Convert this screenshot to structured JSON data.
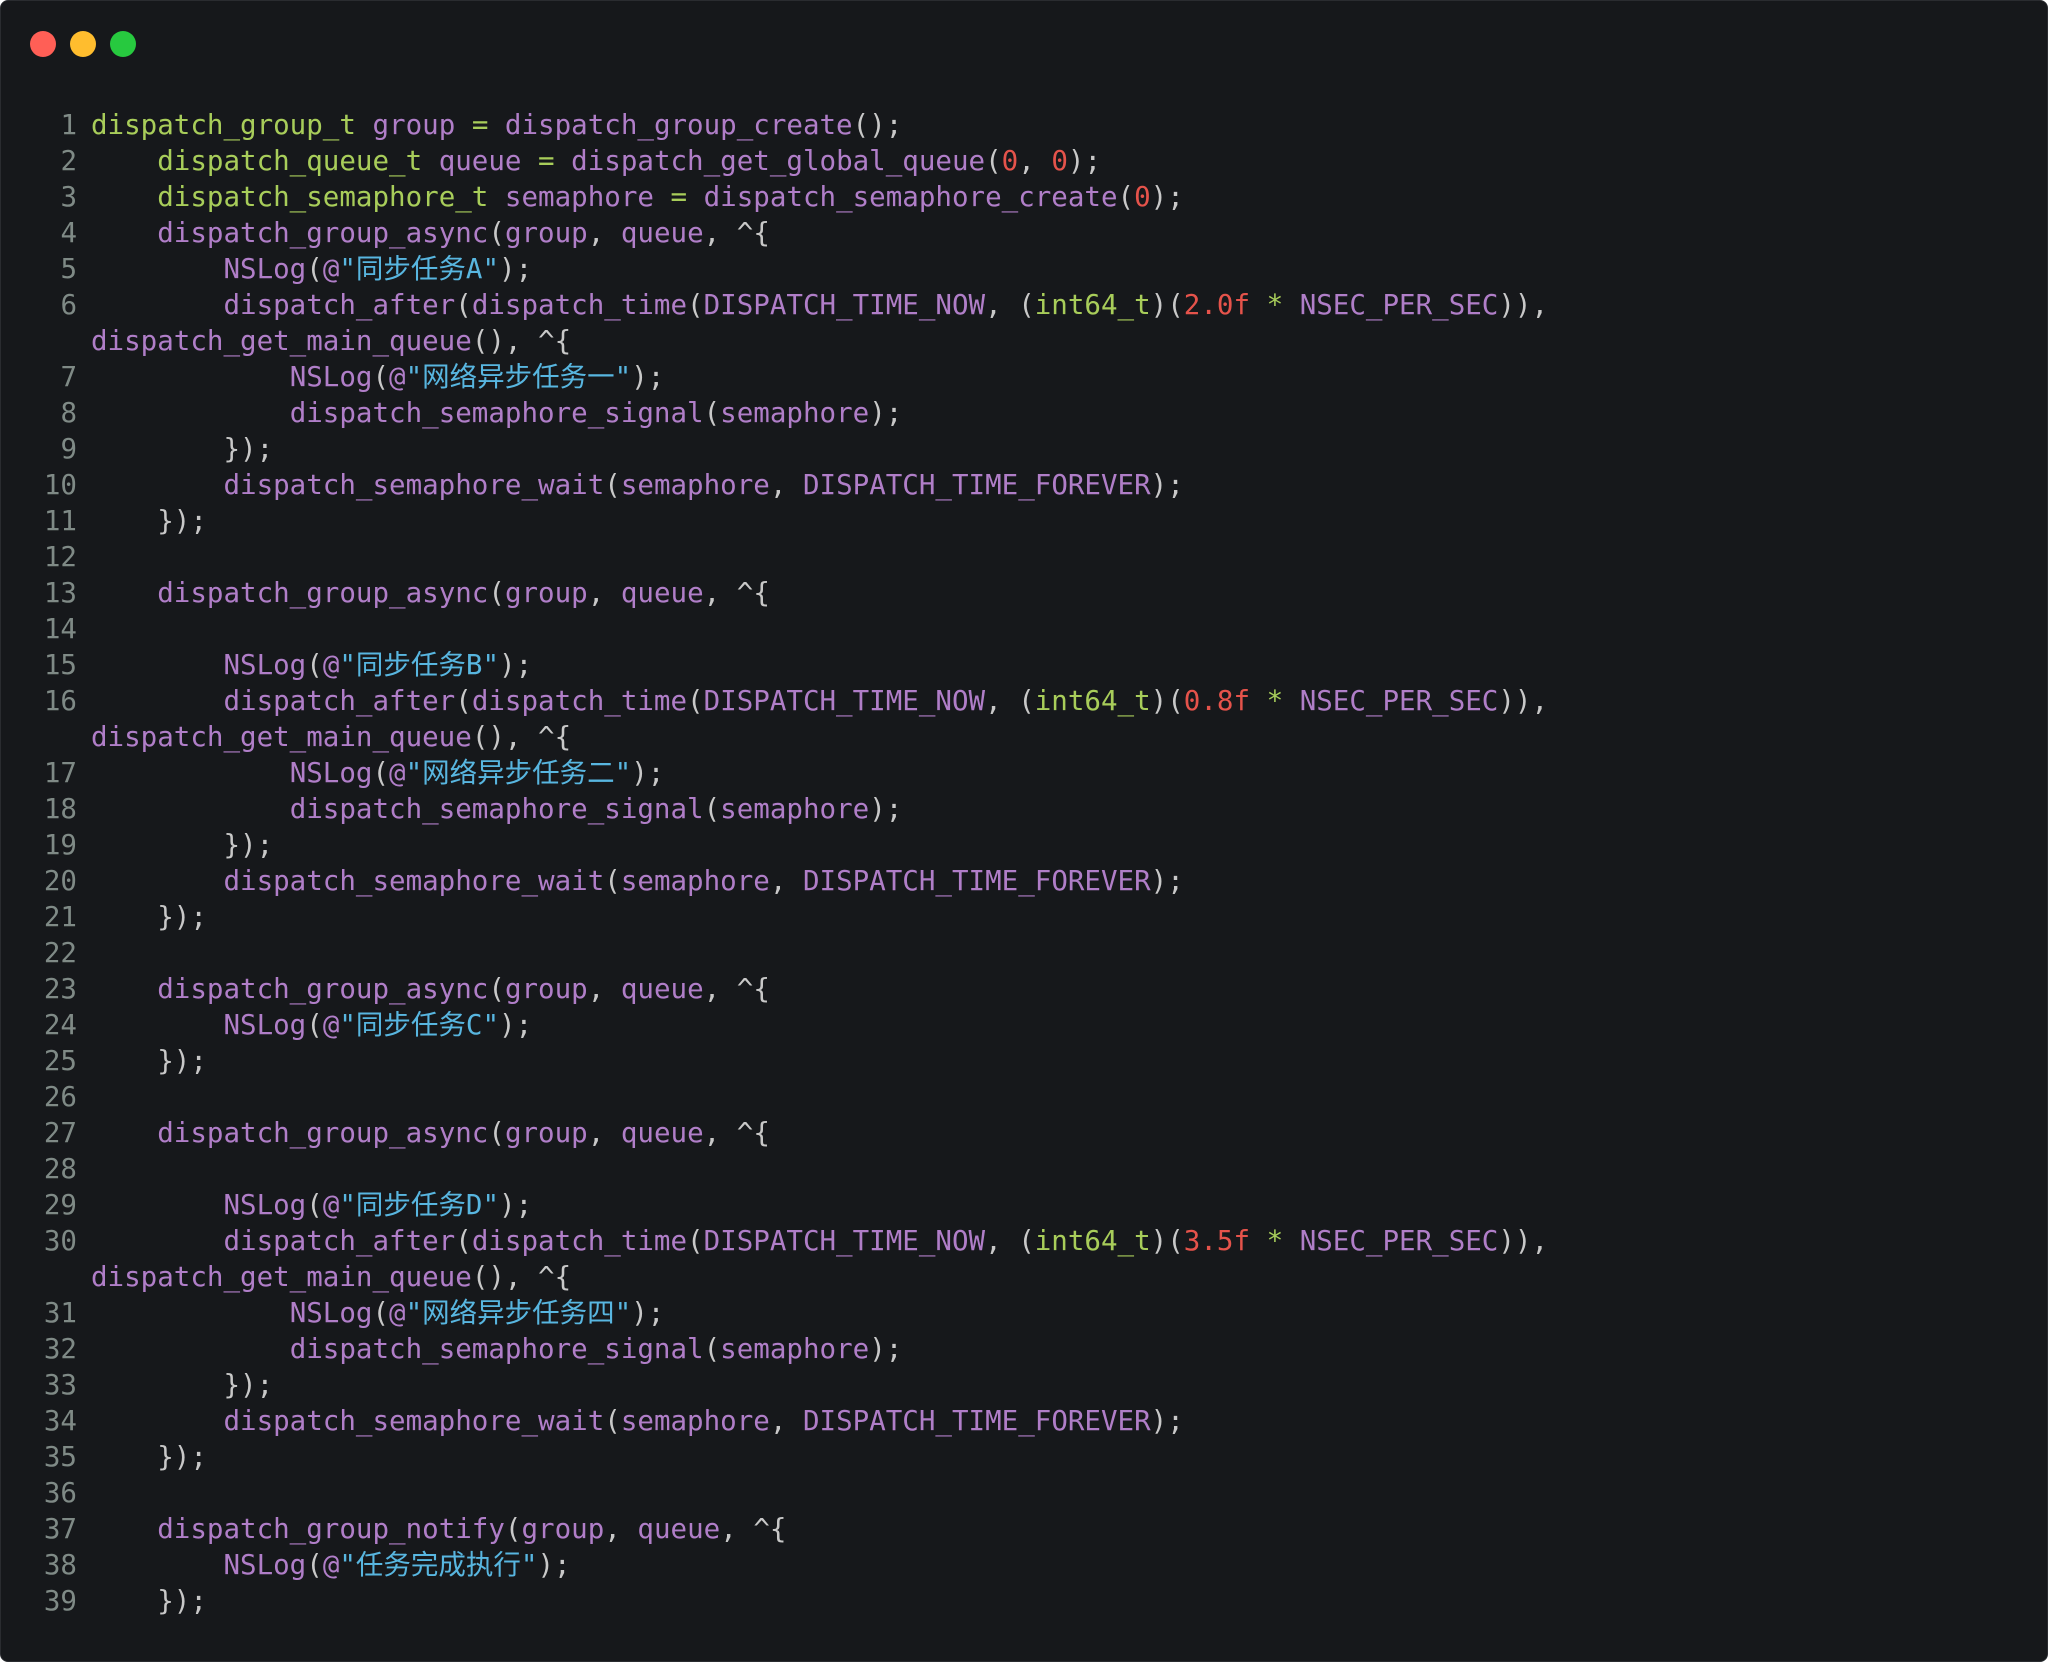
{
  "window": {
    "traffic_lights": [
      {
        "name": "close-button",
        "color": "#ff5f56"
      },
      {
        "name": "minimize-button",
        "color": "#ffbd2e"
      },
      {
        "name": "zoom-button",
        "color": "#27c93f"
      }
    ]
  },
  "colors": {
    "background": "#16181b",
    "line_number": "#7f8a86",
    "default": "#c8c8c8",
    "function": "#b07ec8",
    "type": "#a8cd5a",
    "number": "#e5534b",
    "string": "#58b6e0"
  },
  "code_lines": [
    {
      "num": "1",
      "tokens": [
        [
          "dispatch_group_t",
          "t"
        ],
        [
          " group ",
          "v"
        ],
        [
          "=",
          "t"
        ],
        [
          " dispatch_group_create",
          "f"
        ],
        [
          "();",
          "p"
        ]
      ]
    },
    {
      "num": "2",
      "tokens": [
        [
          "    "
        ],
        [
          "dispatch_queue_t",
          "t"
        ],
        [
          " queue ",
          "f"
        ],
        [
          "=",
          "t"
        ],
        [
          " dispatch_get_global_queue",
          "f"
        ],
        [
          "(",
          "p"
        ],
        [
          "0",
          "n"
        ],
        [
          ", ",
          "p"
        ],
        [
          "0",
          "n"
        ],
        [
          ");",
          "p"
        ]
      ]
    },
    {
      "num": "3",
      "tokens": [
        [
          "    "
        ],
        [
          "dispatch_semaphore_t",
          "t"
        ],
        [
          " semaphore ",
          "f"
        ],
        [
          "=",
          "t"
        ],
        [
          " dispatch_semaphore_create",
          "f"
        ],
        [
          "(",
          "p"
        ],
        [
          "0",
          "n"
        ],
        [
          ");",
          "p"
        ]
      ]
    },
    {
      "num": "4",
      "tokens": [
        [
          "    "
        ],
        [
          "dispatch_group_async",
          "f"
        ],
        [
          "(",
          "p"
        ],
        [
          "group",
          "f"
        ],
        [
          ", ",
          "p"
        ],
        [
          "queue",
          "f"
        ],
        [
          ", ^{",
          "p"
        ]
      ]
    },
    {
      "num": "5",
      "tokens": [
        [
          "        "
        ],
        [
          "NSLog",
          "f"
        ],
        [
          "(",
          "p"
        ],
        [
          "@",
          "f"
        ],
        [
          "\"同步任务A\"",
          "s"
        ],
        [
          ");",
          "p"
        ]
      ]
    },
    {
      "num": "6",
      "tokens": [
        [
          "        "
        ],
        [
          "dispatch_after",
          "f"
        ],
        [
          "(",
          "p"
        ],
        [
          "dispatch_time",
          "f"
        ],
        [
          "(",
          "p"
        ],
        [
          "DISPATCH_TIME_NOW",
          "f"
        ],
        [
          ", (",
          "p"
        ],
        [
          "int64_t",
          "t"
        ],
        [
          ")(",
          "p"
        ],
        [
          "2.0f",
          "n"
        ],
        [
          " * ",
          "t"
        ],
        [
          "NSEC_PER_SEC",
          "f"
        ],
        [
          ")),",
          "p"
        ]
      ]
    },
    {
      "num": "",
      "tokens": [
        [
          "dispatch_get_main_queue",
          "f"
        ],
        [
          "(), ^{",
          "p"
        ]
      ]
    },
    {
      "num": "7",
      "tokens": [
        [
          "            "
        ],
        [
          "NSLog",
          "f"
        ],
        [
          "(",
          "p"
        ],
        [
          "@",
          "f"
        ],
        [
          "\"网络异步任务一\"",
          "s"
        ],
        [
          ");",
          "p"
        ]
      ]
    },
    {
      "num": "8",
      "tokens": [
        [
          "            "
        ],
        [
          "dispatch_semaphore_signal",
          "f"
        ],
        [
          "(",
          "p"
        ],
        [
          "semaphore",
          "f"
        ],
        [
          ");",
          "p"
        ]
      ]
    },
    {
      "num": "9",
      "tokens": [
        [
          "        "
        ],
        [
          "});",
          "p"
        ]
      ]
    },
    {
      "num": "10",
      "tokens": [
        [
          "        "
        ],
        [
          "dispatch_semaphore_wait",
          "f"
        ],
        [
          "(",
          "p"
        ],
        [
          "semaphore",
          "f"
        ],
        [
          ", ",
          "p"
        ],
        [
          "DISPATCH_TIME_FOREVER",
          "f"
        ],
        [
          ");",
          "p"
        ]
      ]
    },
    {
      "num": "11",
      "tokens": [
        [
          "    "
        ],
        [
          "});",
          "p"
        ]
      ]
    },
    {
      "num": "12",
      "tokens": []
    },
    {
      "num": "13",
      "tokens": [
        [
          "    "
        ],
        [
          "dispatch_group_async",
          "f"
        ],
        [
          "(",
          "p"
        ],
        [
          "group",
          "f"
        ],
        [
          ", ",
          "p"
        ],
        [
          "queue",
          "f"
        ],
        [
          ", ^{",
          "p"
        ]
      ]
    },
    {
      "num": "14",
      "tokens": []
    },
    {
      "num": "15",
      "tokens": [
        [
          "        "
        ],
        [
          "NSLog",
          "f"
        ],
        [
          "(",
          "p"
        ],
        [
          "@",
          "f"
        ],
        [
          "\"同步任务B\"",
          "s"
        ],
        [
          ");",
          "p"
        ]
      ]
    },
    {
      "num": "16",
      "tokens": [
        [
          "        "
        ],
        [
          "dispatch_after",
          "f"
        ],
        [
          "(",
          "p"
        ],
        [
          "dispatch_time",
          "f"
        ],
        [
          "(",
          "p"
        ],
        [
          "DISPATCH_TIME_NOW",
          "f"
        ],
        [
          ", (",
          "p"
        ],
        [
          "int64_t",
          "t"
        ],
        [
          ")(",
          "p"
        ],
        [
          "0.8f",
          "n"
        ],
        [
          " * ",
          "t"
        ],
        [
          "NSEC_PER_SEC",
          "f"
        ],
        [
          ")),",
          "p"
        ]
      ]
    },
    {
      "num": "",
      "tokens": [
        [
          "dispatch_get_main_queue",
          "f"
        ],
        [
          "(), ^{",
          "p"
        ]
      ]
    },
    {
      "num": "17",
      "tokens": [
        [
          "            "
        ],
        [
          "NSLog",
          "f"
        ],
        [
          "(",
          "p"
        ],
        [
          "@",
          "f"
        ],
        [
          "\"网络异步任务二\"",
          "s"
        ],
        [
          ");",
          "p"
        ]
      ]
    },
    {
      "num": "18",
      "tokens": [
        [
          "            "
        ],
        [
          "dispatch_semaphore_signal",
          "f"
        ],
        [
          "(",
          "p"
        ],
        [
          "semaphore",
          "f"
        ],
        [
          ");",
          "p"
        ]
      ]
    },
    {
      "num": "19",
      "tokens": [
        [
          "        "
        ],
        [
          "});",
          "p"
        ]
      ]
    },
    {
      "num": "20",
      "tokens": [
        [
          "        "
        ],
        [
          "dispatch_semaphore_wait",
          "f"
        ],
        [
          "(",
          "p"
        ],
        [
          "semaphore",
          "f"
        ],
        [
          ", ",
          "p"
        ],
        [
          "DISPATCH_TIME_FOREVER",
          "f"
        ],
        [
          ");",
          "p"
        ]
      ]
    },
    {
      "num": "21",
      "tokens": [
        [
          "    "
        ],
        [
          "});",
          "p"
        ]
      ]
    },
    {
      "num": "22",
      "tokens": []
    },
    {
      "num": "23",
      "tokens": [
        [
          "    "
        ],
        [
          "dispatch_group_async",
          "f"
        ],
        [
          "(",
          "p"
        ],
        [
          "group",
          "f"
        ],
        [
          ", ",
          "p"
        ],
        [
          "queue",
          "f"
        ],
        [
          ", ^{",
          "p"
        ]
      ]
    },
    {
      "num": "24",
      "tokens": [
        [
          "        "
        ],
        [
          "NSLog",
          "f"
        ],
        [
          "(",
          "p"
        ],
        [
          "@",
          "f"
        ],
        [
          "\"同步任务C\"",
          "s"
        ],
        [
          ");",
          "p"
        ]
      ]
    },
    {
      "num": "25",
      "tokens": [
        [
          "    "
        ],
        [
          "});",
          "p"
        ]
      ]
    },
    {
      "num": "26",
      "tokens": []
    },
    {
      "num": "27",
      "tokens": [
        [
          "    "
        ],
        [
          "dispatch_group_async",
          "f"
        ],
        [
          "(",
          "p"
        ],
        [
          "group",
          "f"
        ],
        [
          ", ",
          "p"
        ],
        [
          "queue",
          "f"
        ],
        [
          ", ^{",
          "p"
        ]
      ]
    },
    {
      "num": "28",
      "tokens": []
    },
    {
      "num": "29",
      "tokens": [
        [
          "        "
        ],
        [
          "NSLog",
          "f"
        ],
        [
          "(",
          "p"
        ],
        [
          "@",
          "f"
        ],
        [
          "\"同步任务D\"",
          "s"
        ],
        [
          ");",
          "p"
        ]
      ]
    },
    {
      "num": "30",
      "tokens": [
        [
          "        "
        ],
        [
          "dispatch_after",
          "f"
        ],
        [
          "(",
          "p"
        ],
        [
          "dispatch_time",
          "f"
        ],
        [
          "(",
          "p"
        ],
        [
          "DISPATCH_TIME_NOW",
          "f"
        ],
        [
          ", (",
          "p"
        ],
        [
          "int64_t",
          "t"
        ],
        [
          ")(",
          "p"
        ],
        [
          "3.5f",
          "n"
        ],
        [
          " * ",
          "t"
        ],
        [
          "NSEC_PER_SEC",
          "f"
        ],
        [
          ")),",
          "p"
        ]
      ]
    },
    {
      "num": "",
      "tokens": [
        [
          "dispatch_get_main_queue",
          "f"
        ],
        [
          "(), ^{",
          "p"
        ]
      ]
    },
    {
      "num": "31",
      "tokens": [
        [
          "            "
        ],
        [
          "NSLog",
          "f"
        ],
        [
          "(",
          "p"
        ],
        [
          "@",
          "f"
        ],
        [
          "\"网络异步任务四\"",
          "s"
        ],
        [
          ");",
          "p"
        ]
      ]
    },
    {
      "num": "32",
      "tokens": [
        [
          "            "
        ],
        [
          "dispatch_semaphore_signal",
          "f"
        ],
        [
          "(",
          "p"
        ],
        [
          "semaphore",
          "f"
        ],
        [
          ");",
          "p"
        ]
      ]
    },
    {
      "num": "33",
      "tokens": [
        [
          "        "
        ],
        [
          "});",
          "p"
        ]
      ]
    },
    {
      "num": "34",
      "tokens": [
        [
          "        "
        ],
        [
          "dispatch_semaphore_wait",
          "f"
        ],
        [
          "(",
          "p"
        ],
        [
          "semaphore",
          "f"
        ],
        [
          ", ",
          "p"
        ],
        [
          "DISPATCH_TIME_FOREVER",
          "f"
        ],
        [
          ");",
          "p"
        ]
      ]
    },
    {
      "num": "35",
      "tokens": [
        [
          "    "
        ],
        [
          "});",
          "p"
        ]
      ]
    },
    {
      "num": "36",
      "tokens": []
    },
    {
      "num": "37",
      "tokens": [
        [
          "    "
        ],
        [
          "dispatch_group_notify",
          "f"
        ],
        [
          "(",
          "p"
        ],
        [
          "group",
          "f"
        ],
        [
          ", ",
          "p"
        ],
        [
          "queue",
          "f"
        ],
        [
          ", ^{",
          "p"
        ]
      ]
    },
    {
      "num": "38",
      "tokens": [
        [
          "        "
        ],
        [
          "NSLog",
          "f"
        ],
        [
          "(",
          "p"
        ],
        [
          "@",
          "f"
        ],
        [
          "\"任务完成执行\"",
          "s"
        ],
        [
          ");",
          "p"
        ]
      ]
    },
    {
      "num": "39",
      "tokens": [
        [
          "    "
        ],
        [
          "});",
          "p"
        ]
      ]
    }
  ]
}
